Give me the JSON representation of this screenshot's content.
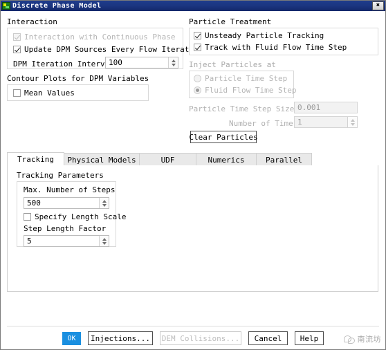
{
  "window": {
    "title": "Discrete Phase Model",
    "close_label": "✖",
    "icon": "fluent-app-icon"
  },
  "interaction": {
    "group_title": "Interaction",
    "checkboxes": [
      {
        "label": "Interaction with Continuous Phase",
        "checked": true,
        "enabled": false
      },
      {
        "label": "Update DPM Sources Every Flow Iteration",
        "checked": true,
        "enabled": true
      }
    ],
    "iteration_interval": {
      "label": "DPM Iteration Interval",
      "value": "100"
    }
  },
  "contour_plots": {
    "group_title": "Contour Plots for DPM Variables",
    "mean_values": {
      "label": "Mean Values",
      "checked": false
    }
  },
  "particle_treatment": {
    "group_title": "Particle Treatment",
    "checkboxes": [
      {
        "label": "Unsteady Particle Tracking",
        "checked": true,
        "enabled": true
      },
      {
        "label": "Track with Fluid Flow Time Step",
        "checked": true,
        "enabled": true
      }
    ],
    "inject_particles": {
      "group_title": "Inject Particles at",
      "options": [
        {
          "label": "Particle Time Step",
          "selected": false
        },
        {
          "label": "Fluid Flow Time Step",
          "selected": true
        }
      ]
    },
    "particle_time_step_size": {
      "label": "Particle Time Step Size (s)",
      "value": "0.001"
    },
    "number_of_time_steps": {
      "label": "Number of Time Steps",
      "value": "1"
    },
    "clear_particles_label": "Clear Particles"
  },
  "tabs": [
    {
      "label": "Tracking",
      "active": true
    },
    {
      "label": "Physical Models",
      "active": false
    },
    {
      "label": "UDF",
      "active": false
    },
    {
      "label": "Numerics",
      "active": false
    },
    {
      "label": "Parallel",
      "active": false
    }
  ],
  "tracking": {
    "group_title": "Tracking Parameters",
    "max_number_of_steps": {
      "label": "Max. Number of Steps",
      "value": "500"
    },
    "specify_length_scale": {
      "label": "Specify Length Scale",
      "checked": false
    },
    "step_length_factor": {
      "label": "Step Length Factor",
      "value": "5"
    }
  },
  "footer": {
    "buttons": [
      {
        "name": "ok",
        "label": "OK",
        "style": "primary",
        "enabled": true
      },
      {
        "name": "injections",
        "label": "Injections...",
        "style": "normal",
        "enabled": true
      },
      {
        "name": "dem-collisions",
        "label": "DEM Collisions...",
        "style": "normal",
        "enabled": false
      },
      {
        "name": "cancel",
        "label": "Cancel",
        "style": "normal",
        "enabled": true
      },
      {
        "name": "help",
        "label": "Help",
        "style": "normal",
        "enabled": true
      }
    ]
  },
  "watermark": {
    "text": "南流坊"
  },
  "colors": {
    "titlebar": "#1b3580",
    "accent": "#1a8fe0",
    "panel_border": "#d8d8d8",
    "disabled_text": "#b5b5b5"
  }
}
